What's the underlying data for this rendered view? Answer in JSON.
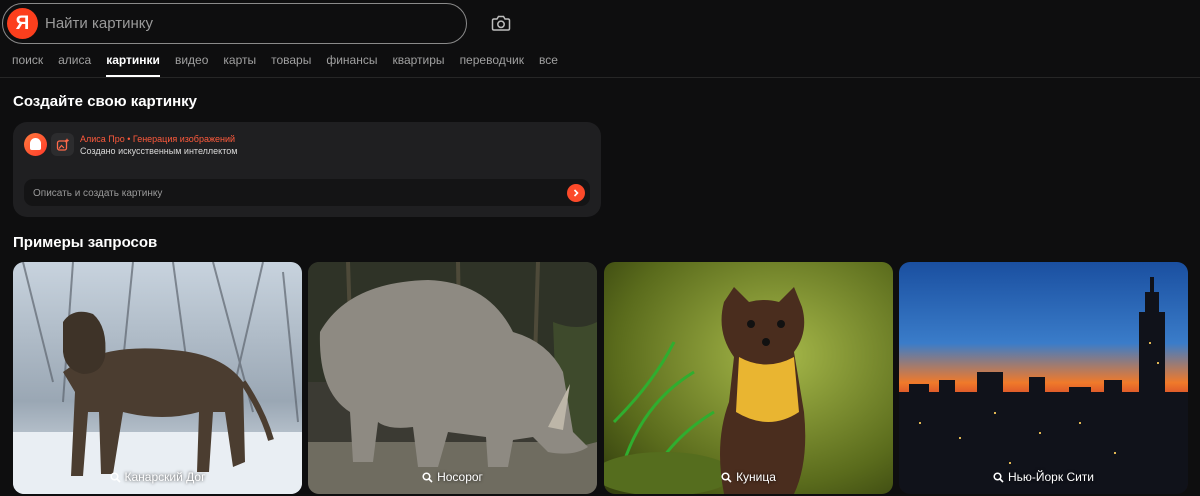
{
  "search": {
    "placeholder": "Найти картинку",
    "logo_letter": "Я"
  },
  "tabs": [
    {
      "label": "поиск"
    },
    {
      "label": "алиса"
    },
    {
      "label": "картинки",
      "active": true
    },
    {
      "label": "видео"
    },
    {
      "label": "карты"
    },
    {
      "label": "товары"
    },
    {
      "label": "финансы"
    },
    {
      "label": "квартиры"
    },
    {
      "label": "переводчик"
    },
    {
      "label": "все"
    }
  ],
  "create": {
    "heading": "Создайте свою картинку",
    "title": "Алиса Про • Генерация изображений",
    "subtitle": "Создано искусственным интеллектом",
    "input_placeholder": "Описать и создать картинку"
  },
  "examples": {
    "heading": "Примеры запросов",
    "items": [
      {
        "label": "Канарский Дог"
      },
      {
        "label": "Носорог"
      },
      {
        "label": "Куница"
      },
      {
        "label": "Нью-Йорк Сити"
      }
    ]
  },
  "colors": {
    "accent": "#fc3f1d",
    "background": "#0e0e0f",
    "card": "#1f1f21"
  }
}
